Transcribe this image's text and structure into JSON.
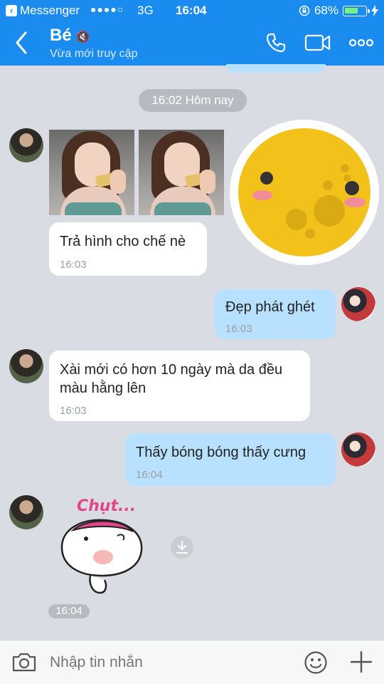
{
  "status_bar": {
    "carrier": "Messenger",
    "signal": "●●●●○",
    "network": "3G",
    "time": "16:04",
    "battery_percent": "68%",
    "battery_level": 0.68
  },
  "header": {
    "contact_name": "Bé",
    "mute_glyph": "🔇",
    "contact_status": "Vừa mới truy cập"
  },
  "chat": {
    "day_separator": "16:02 Hôm nay",
    "messages": [
      {
        "text": "Trả hình cho chế nè",
        "time": "16:03"
      },
      {
        "text": "Đẹp phát ghét",
        "time": "16:03"
      },
      {
        "text_line1": "Xài mới có hơn 10 ngày mà da đều",
        "text_line2": "màu hằng lên",
        "time": "16:03"
      },
      {
        "text": "Thấy bóng bóng thấy cưng",
        "time": "16:04"
      }
    ],
    "sticker_caption": "Chụt...",
    "sticker_time": "16:04"
  },
  "composer": {
    "placeholder": "Nhập tin nhắn"
  },
  "colors": {
    "header_bg": "#1a8cf0",
    "incoming_bubble": "#ffffff",
    "outgoing_bubble": "#b8e0ff",
    "chat_bg": "#d9dde3"
  },
  "icons": [
    "back-chevron-icon",
    "mute-icon",
    "phone-icon",
    "video-camera-icon",
    "more-icon",
    "download-icon",
    "camera-icon",
    "emoji-icon",
    "plus-icon"
  ]
}
